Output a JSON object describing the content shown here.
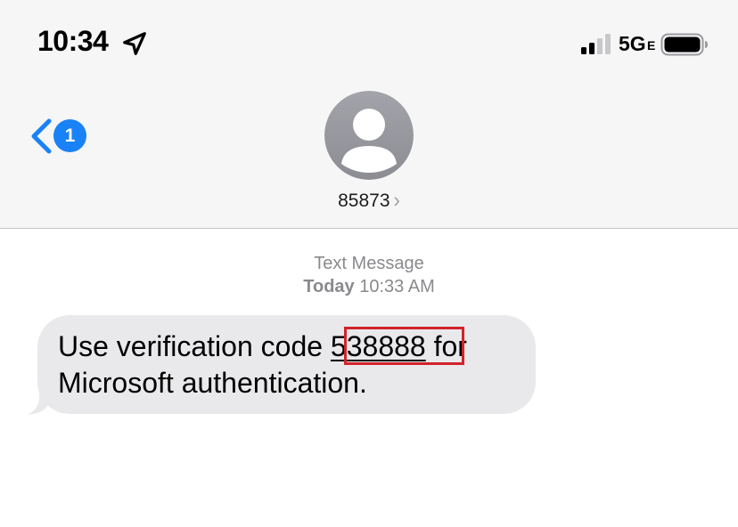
{
  "status_bar": {
    "time": "10:34",
    "network": "5G",
    "network_suffix": "E",
    "icons": [
      "location-arrow-icon",
      "signal-bars-icon",
      "battery-icon"
    ]
  },
  "nav": {
    "back_badge": "1",
    "contact_name": "85873",
    "icons": [
      "back-chevron-icon",
      "avatar-person-icon",
      "contact-chevron-icon"
    ]
  },
  "conversation": {
    "service_label": "Text Message",
    "timestamp_day": "Today",
    "timestamp_time": "10:33 AM",
    "message": {
      "text_before": "Use verification code ",
      "code": "538888",
      "text_after": " for Microsoft authentication."
    }
  },
  "colors": {
    "accent": "#1a82f7",
    "bubble": "#e9e9eb",
    "header_bg": "#f6f6f7",
    "highlight": "#d2232a",
    "meta_text": "#8a8a8e",
    "avatar_bg": "#9a9aa1"
  }
}
